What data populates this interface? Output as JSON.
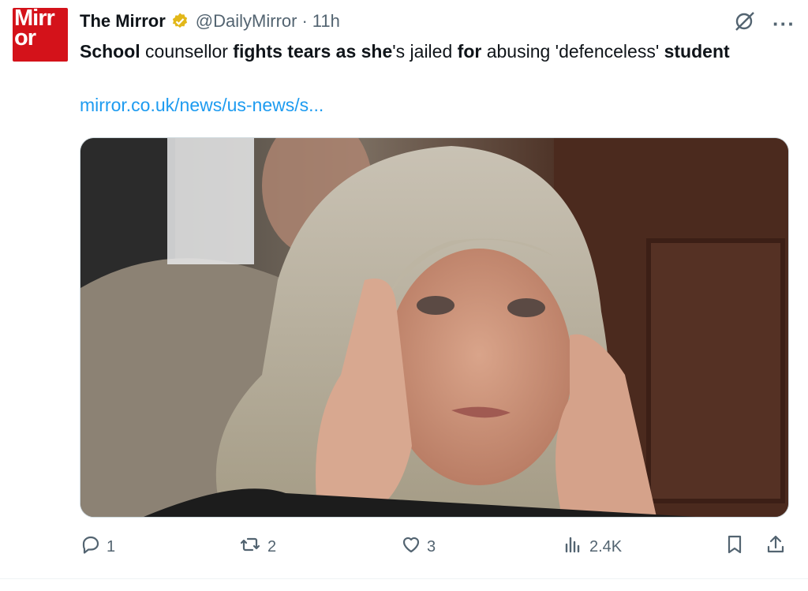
{
  "avatar": {
    "line1": "Mirr",
    "line2": "or"
  },
  "account": {
    "name": "The Mirror",
    "handle": "@DailyMirror",
    "separator": "·",
    "time": "11h"
  },
  "tweet": {
    "segments": [
      {
        "text": "School",
        "bold": true
      },
      {
        "text": " counsellor ",
        "bold": false
      },
      {
        "text": "fights tears as she",
        "bold": true
      },
      {
        "text": "'s jailed ",
        "bold": false
      },
      {
        "text": "for",
        "bold": true
      },
      {
        "text": " abusing 'defenceless' ",
        "bold": false
      },
      {
        "text": "student",
        "bold": true
      }
    ],
    "link": "mirror.co.uk/news/us-news/s..."
  },
  "actions": {
    "replies": "1",
    "reposts": "2",
    "likes": "3",
    "views": "2.4K"
  },
  "colors": {
    "brand": "#d4121a",
    "link": "#1d9bf0",
    "muted": "#536471",
    "verified": "#e2b719"
  },
  "icons": {
    "grok": "grok-icon",
    "more": "more-icon",
    "reply": "reply-icon",
    "repost": "repost-icon",
    "like": "heart-icon",
    "views": "views-icon",
    "bookmark": "bookmark-icon",
    "share": "share-icon"
  }
}
